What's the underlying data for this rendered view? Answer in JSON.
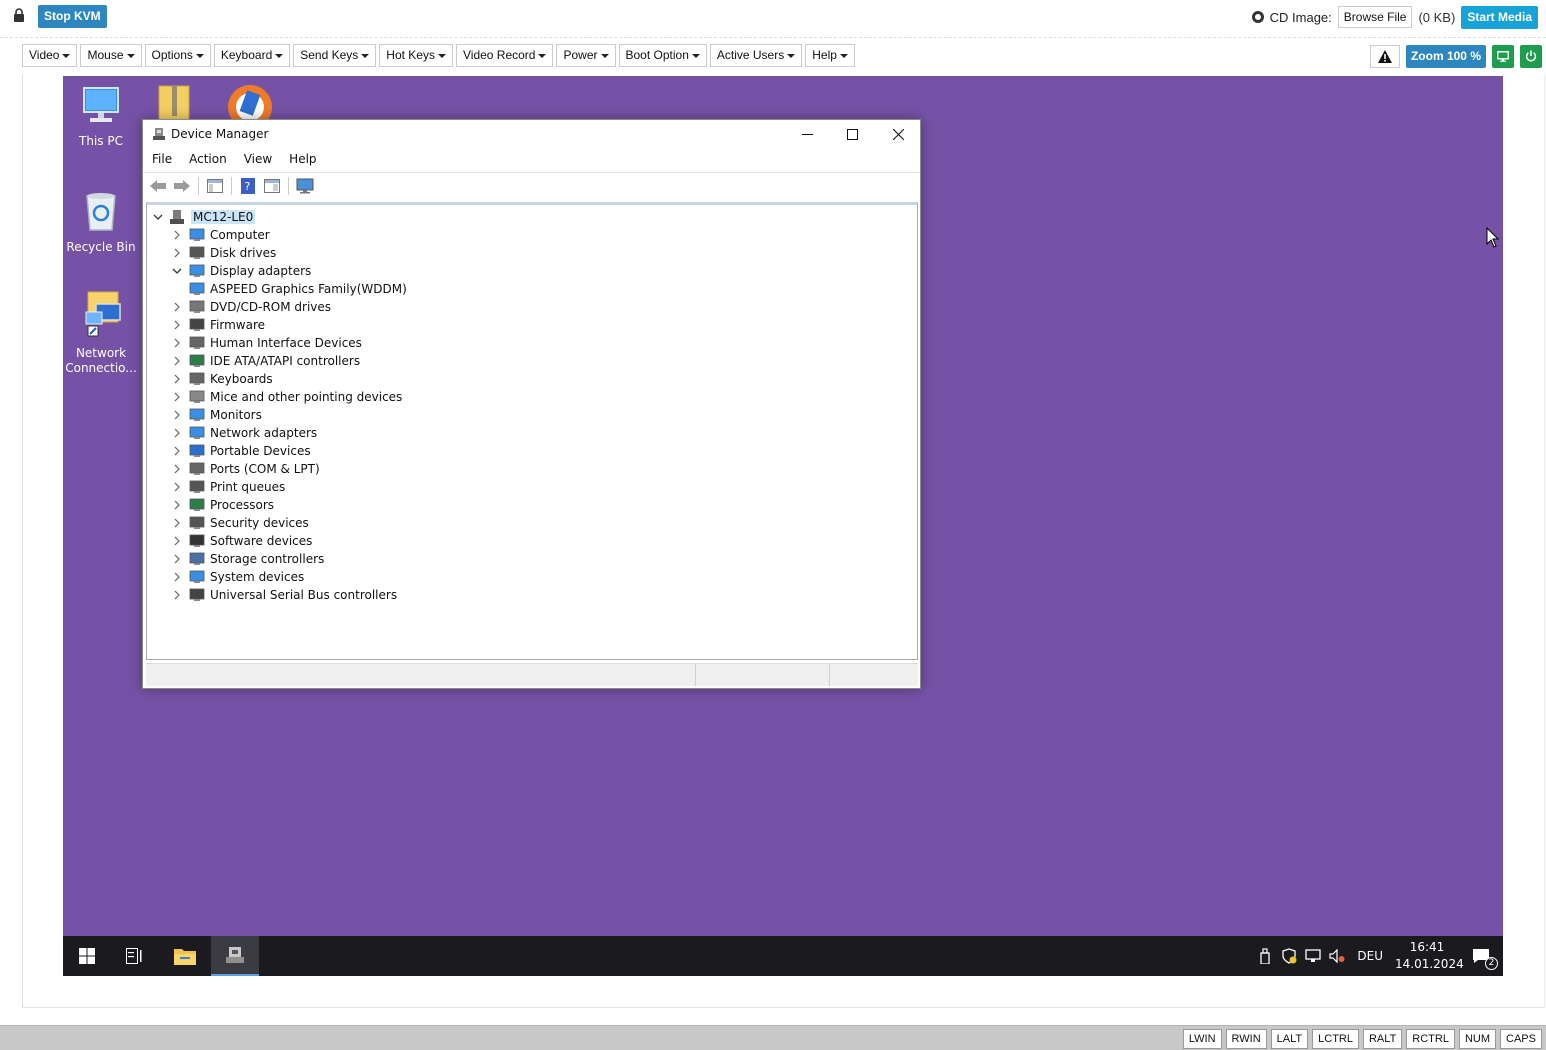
{
  "topbar": {
    "stop_kvm": "Stop KVM",
    "cd_image_label": "CD Image:",
    "browse_file": "Browse File",
    "cd_size": "(0 KB)",
    "start_media": "Start Media"
  },
  "menubar": {
    "items": [
      {
        "label": "Video"
      },
      {
        "label": "Mouse"
      },
      {
        "label": "Options"
      },
      {
        "label": "Keyboard"
      },
      {
        "label": "Send Keys"
      },
      {
        "label": "Hot Keys"
      },
      {
        "label": "Video Record"
      },
      {
        "label": "Power"
      },
      {
        "label": "Boot Option"
      },
      {
        "label": "Active Users"
      },
      {
        "label": "Help"
      }
    ],
    "zoom": "Zoom 100 %"
  },
  "desktop": {
    "icons": [
      {
        "label": "This PC"
      },
      {
        "label": "Recycle Bin"
      },
      {
        "label": "Network Connectio..."
      }
    ],
    "background_color": "#7552a6"
  },
  "device_manager": {
    "title": "Device Manager",
    "menu": [
      "File",
      "Action",
      "View",
      "Help"
    ],
    "root": "MC12-LE0",
    "nodes": [
      {
        "label": "Computer",
        "expanded": false
      },
      {
        "label": "Disk drives",
        "expanded": false
      },
      {
        "label": "Display adapters",
        "expanded": true
      },
      {
        "label": "ASPEED Graphics Family(WDDM)",
        "child": true
      },
      {
        "label": "DVD/CD-ROM drives",
        "expanded": false
      },
      {
        "label": "Firmware",
        "expanded": false
      },
      {
        "label": "Human Interface Devices",
        "expanded": false
      },
      {
        "label": "IDE ATA/ATAPI controllers",
        "expanded": false
      },
      {
        "label": "Keyboards",
        "expanded": false
      },
      {
        "label": "Mice and other pointing devices",
        "expanded": false
      },
      {
        "label": "Monitors",
        "expanded": false
      },
      {
        "label": "Network adapters",
        "expanded": false
      },
      {
        "label": "Portable Devices",
        "expanded": false
      },
      {
        "label": "Ports (COM & LPT)",
        "expanded": false
      },
      {
        "label": "Print queues",
        "expanded": false
      },
      {
        "label": "Processors",
        "expanded": false
      },
      {
        "label": "Security devices",
        "expanded": false
      },
      {
        "label": "Software devices",
        "expanded": false
      },
      {
        "label": "Storage controllers",
        "expanded": false
      },
      {
        "label": "System devices",
        "expanded": false
      },
      {
        "label": "Universal Serial Bus controllers",
        "expanded": false
      }
    ]
  },
  "taskbar": {
    "language": "DEU",
    "time": "16:41",
    "date": "14.01.2024",
    "notification_count": "2"
  },
  "keys": [
    "LWIN",
    "RWIN",
    "LALT",
    "LCTRL",
    "RALT",
    "RCTRL",
    "NUM",
    "CAPS"
  ],
  "colors": {
    "primary_button": "#2e86c1",
    "media_button": "#17a2d8",
    "power_green": "#1e9d4e",
    "taskbar": "#1b1b1f",
    "tree_selection": "#cce4f7"
  }
}
